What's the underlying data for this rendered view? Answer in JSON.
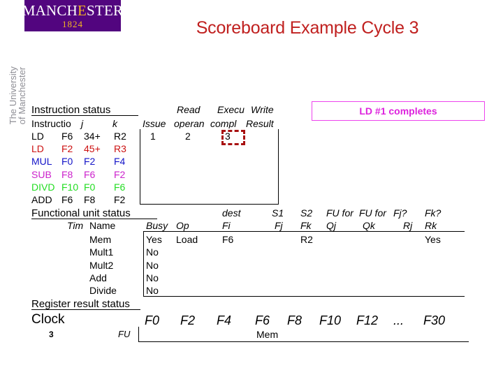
{
  "logo": {
    "wordmark_pre": "MANCH",
    "wordmark_gold": "E",
    "wordmark_post": "STER",
    "year": "1824",
    "vertical_line1": "The University",
    "vertical_line2": "of Manchester"
  },
  "title": "Scoreboard Example Cycle 3",
  "callout": {
    "text": "LD #1 completes",
    "color": "#dd22dd"
  },
  "instruction_status": {
    "section_label": "Instruction status",
    "header_top": {
      "read": "Read",
      "exec": "Execu",
      "write": "Write"
    },
    "header_bottom": {
      "instruction": "Instructio",
      "j": "j",
      "k": "k",
      "issue": "Issue",
      "read_operands": "operan",
      "exec_complete": "compl",
      "write_result": "Result"
    },
    "rows": [
      {
        "op": "LD",
        "dest": "F6",
        "j": "34+",
        "k": "R2",
        "issue": "1",
        "read": "2",
        "exec": "3",
        "write": "",
        "color": "#000000"
      },
      {
        "op": "LD",
        "dest": "F2",
        "j": "45+",
        "k": "R3",
        "issue": "",
        "read": "",
        "exec": "",
        "write": "",
        "color": "#cc1111"
      },
      {
        "op": "MUL",
        "dest": "F0",
        "j": "F2",
        "k": "F4",
        "issue": "",
        "read": "",
        "exec": "",
        "write": "",
        "color": "#1414c8"
      },
      {
        "op": "SUB",
        "dest": "F8",
        "j": "F6",
        "k": "F2",
        "issue": "",
        "read": "",
        "exec": "",
        "write": "",
        "color": "#cc22cc"
      },
      {
        "op": "DIVD",
        "dest": "F10",
        "j": "F0",
        "k": "F6",
        "issue": "",
        "read": "",
        "exec": "",
        "write": "",
        "color": "#22dd22"
      },
      {
        "op": "ADD",
        "dest": "F6",
        "j": "F8",
        "k": "F2",
        "issue": "",
        "read": "",
        "exec": "",
        "write": "",
        "color": "#000000"
      }
    ],
    "highlight_cell": "3"
  },
  "functional_unit_status": {
    "section_label": "Functional unit status",
    "header_top": {
      "dest": "dest",
      "s1": "S1",
      "s2": "S2",
      "fu_for_j": "FU for",
      "fu_for_k": "FU for",
      "fj_ready": "Fj?",
      "fk_ready": "Fk?"
    },
    "header_bottom": {
      "time": "Tim",
      "name": "Name",
      "busy": "Busy",
      "op": "Op",
      "fi": "Fi",
      "fj": "Fj",
      "fk": "Fk",
      "qj": "Qj",
      "qk": "Qk",
      "rj": "Rj",
      "rk": "Rk"
    },
    "rows": [
      {
        "time": "",
        "name": "Mem",
        "busy": "Yes",
        "op": "Load",
        "fi": "F6",
        "fj": "",
        "fk": "R2",
        "qj": "",
        "qk": "",
        "rj": "",
        "rk": "Yes"
      },
      {
        "time": "",
        "name": "Mult1",
        "busy": "No",
        "op": "",
        "fi": "",
        "fj": "",
        "fk": "",
        "qj": "",
        "qk": "",
        "rj": "",
        "rk": ""
      },
      {
        "time": "",
        "name": "Mult2",
        "busy": "No",
        "op": "",
        "fi": "",
        "fj": "",
        "fk": "",
        "qj": "",
        "qk": "",
        "rj": "",
        "rk": ""
      },
      {
        "time": "",
        "name": "Add",
        "busy": "No",
        "op": "",
        "fi": "",
        "fj": "",
        "fk": "",
        "qj": "",
        "qk": "",
        "rj": "",
        "rk": ""
      },
      {
        "time": "",
        "name": "Divide",
        "busy": "No",
        "op": "",
        "fi": "",
        "fj": "",
        "fk": "",
        "qj": "",
        "qk": "",
        "rj": "",
        "rk": ""
      }
    ]
  },
  "register_result_status": {
    "section_label": "Register result status",
    "clock_label": "Clock",
    "clock_value": "3",
    "fu_label": "FU",
    "registers": [
      "F0",
      "F2",
      "F4",
      "F6",
      "F8",
      "F10",
      "F12",
      "...",
      "F30"
    ],
    "values": [
      "",
      "",
      "",
      "Mem",
      "",
      "",
      "",
      "",
      ""
    ]
  }
}
